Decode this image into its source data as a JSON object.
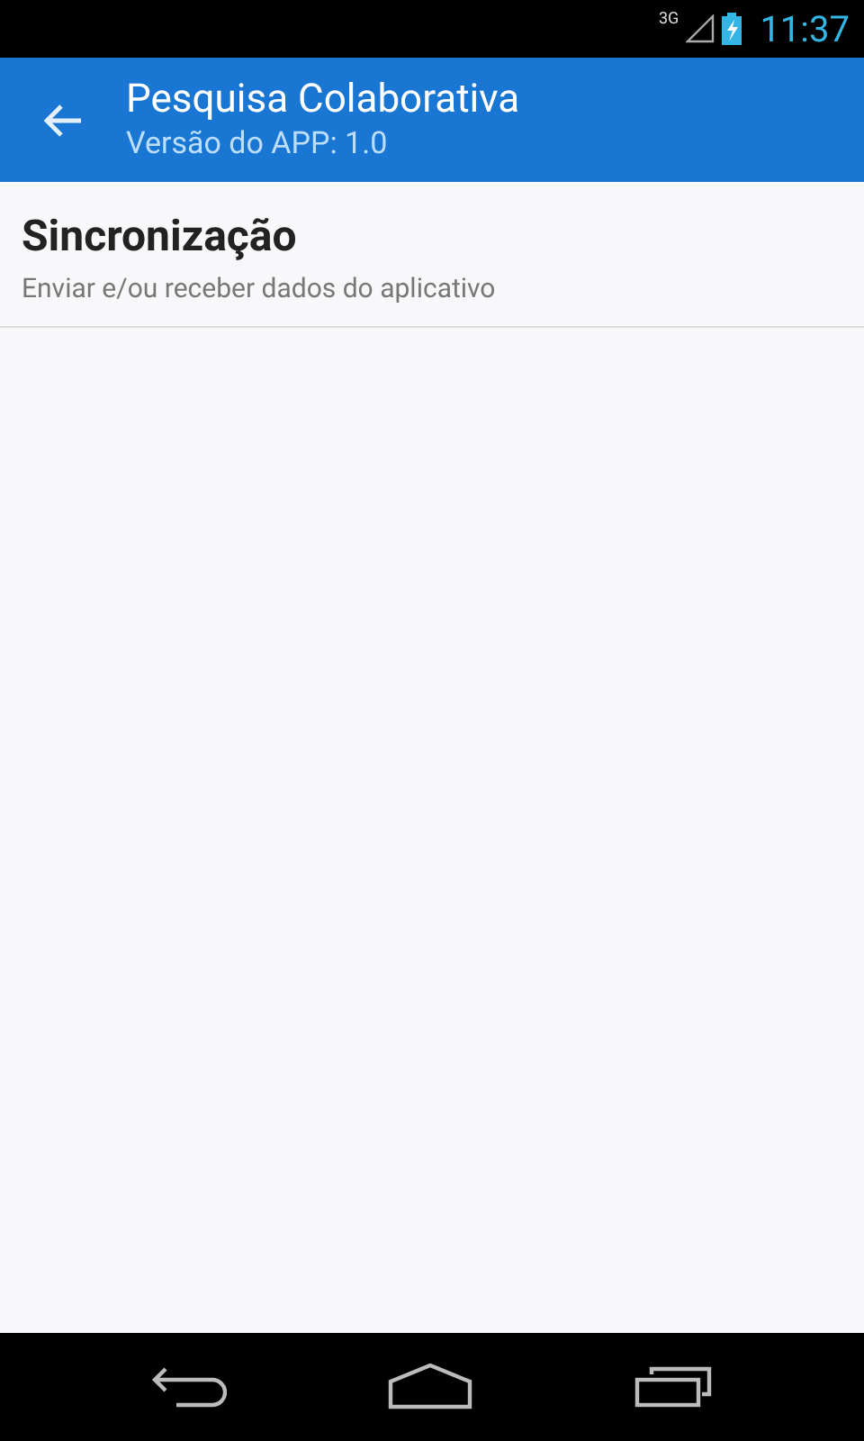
{
  "status_bar": {
    "network": "3G",
    "time": "11:37"
  },
  "app_bar": {
    "title": "Pesquisa Colaborativa",
    "subtitle": "Versão do APP: 1.0"
  },
  "preferences": [
    {
      "title": "Sincronização",
      "summary": "Enviar e/ou receber dados do aplicativo"
    }
  ]
}
